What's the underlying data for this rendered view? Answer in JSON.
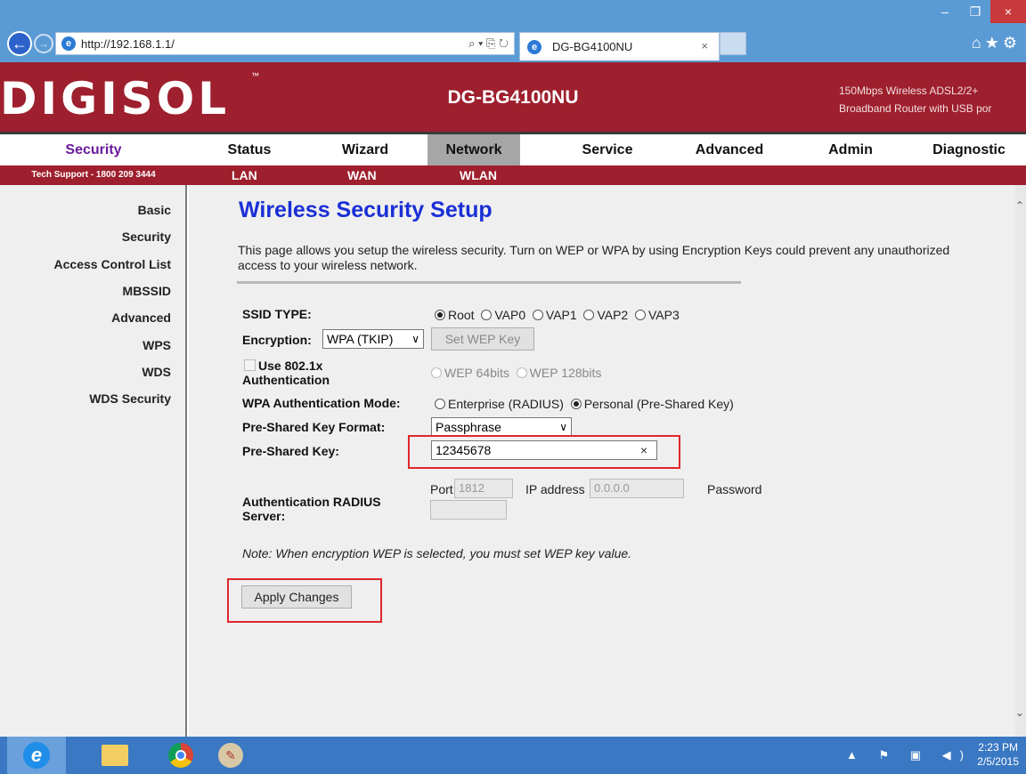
{
  "browser": {
    "url": "http://192.168.1.1/",
    "tab_title": "DG-BG4100NU",
    "addr_tools": "⌕ ▾ ⎘ ↻",
    "tab_close": "×",
    "toolbar_icons": "⌂★⚙",
    "win_minimize": "–",
    "win_restore": "❐",
    "win_close": "×"
  },
  "header": {
    "logo": "DIGISOL",
    "logo_tm": "™",
    "model": "DG-BG4100NU",
    "tagline_1": "150Mbps Wireless ADSL2/2+",
    "tagline_2": "Broadband Router with USB por"
  },
  "nav": {
    "section": "Security",
    "items": [
      "Status",
      "Wizard",
      "Network",
      "Service",
      "Advanced",
      "Admin",
      "Diagnostic"
    ],
    "support": "Tech Support - 1800 209 3444",
    "sub_items": [
      "LAN",
      "WAN",
      "WLAN"
    ]
  },
  "sidebar": {
    "items": [
      "Basic",
      "Security",
      "Access Control List",
      "MBSSID",
      "Advanced",
      "WPS",
      "WDS",
      "WDS Security"
    ]
  },
  "page": {
    "title": "Wireless Security Setup",
    "description": "This page allows you setup the wireless security. Turn on WEP or WPA by using Encryption Keys could prevent any unauthorized access to your wireless network.",
    "ssid_label": "SSID TYPE:",
    "ssid_options": [
      "Root",
      "VAP0",
      "VAP1",
      "VAP2",
      "VAP3"
    ],
    "ssid_selected": "Root",
    "encryption_label": "Encryption:",
    "encryption_value": "WPA (TKIP)",
    "set_wep_key": "Set WEP Key",
    "use_8021x_1": "Use 802.1x",
    "use_8021x_2": "Authentication",
    "wep_64": "WEP 64bits",
    "wep_128": "WEP 128bits",
    "wpa_mode_label": "WPA Authentication Mode:",
    "wpa_enterprise": "Enterprise (RADIUS)",
    "wpa_personal": "Personal (Pre-Shared Key)",
    "psk_format_label": "Pre-Shared Key Format:",
    "psk_format_value": "Passphrase",
    "psk_label": "Pre-Shared Key:",
    "psk_value": "12345678",
    "radius_label_1": "Authentication RADIUS",
    "radius_label_2": "Server:",
    "port_label": "Port",
    "port_value": "1812",
    "ip_label": "IP address",
    "ip_value": "0.0.0.0",
    "password_label": "Password",
    "note": "Note: When encryption WEP is selected, you must set WEP key value.",
    "apply": "Apply Changes",
    "clear_icon": "×",
    "chevron": "∨"
  },
  "taskbar": {
    "tray_icons": "▲ ⚑ ▣ ◀)",
    "time": "2:23 PM",
    "date": "2/5/2015",
    "ie_glyph": "e",
    "paint_glyph": "✎"
  }
}
